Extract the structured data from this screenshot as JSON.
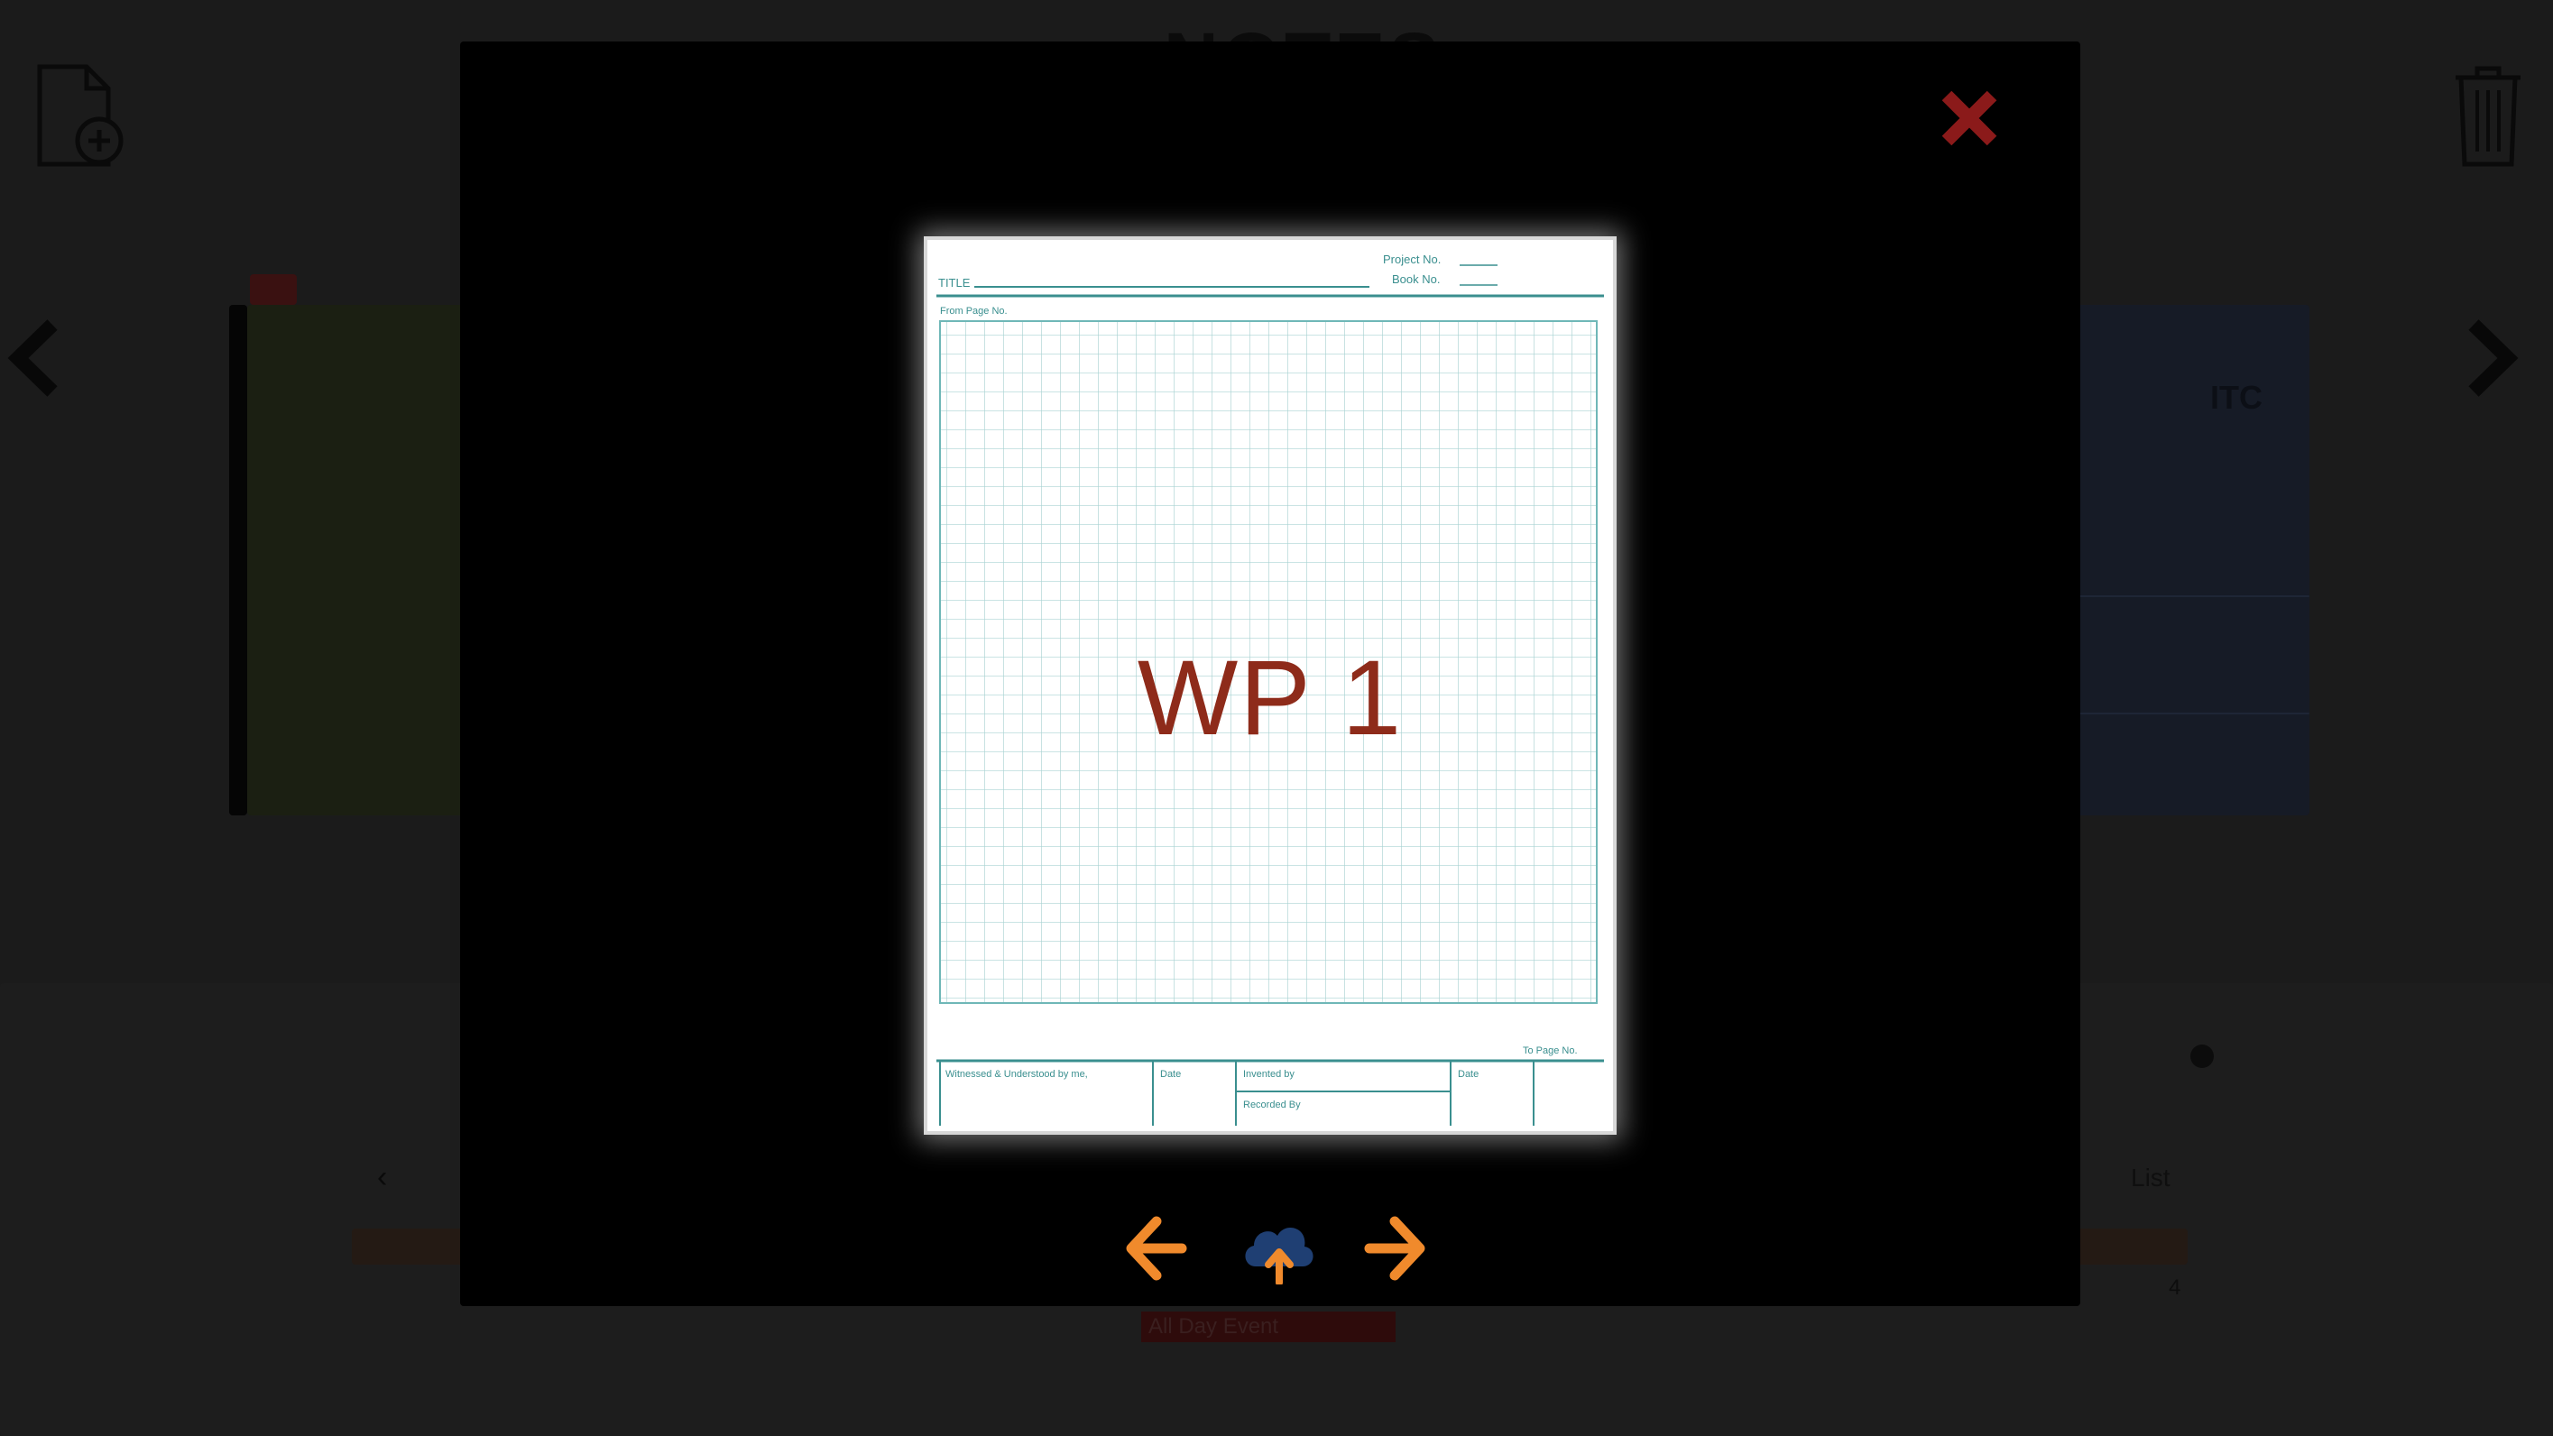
{
  "app": {
    "title": "NOTES",
    "new_note_icon": "file-plus-icon",
    "trash_icon": "trash-icon",
    "right_card_label": "ITC",
    "list_label": "List",
    "count": "4",
    "event_label": "All Day Event"
  },
  "modal": {
    "close_icon": "close-icon",
    "image_label": "WP 1",
    "sheet": {
      "title_label": "TITLE",
      "project_label": "Project No.",
      "book_label": "Book No.",
      "from_page": "From Page No.",
      "to_page": "To Page No.",
      "witnessed": "Witnessed & Understood by me,",
      "date_label": "Date",
      "invented_label": "Invented by",
      "date2_label": "Date",
      "recorded_label": "Recorded By"
    },
    "prev_icon": "arrow-left-icon",
    "upload_icon": "cloud-upload-icon",
    "next_icon": "arrow-right-icon"
  },
  "colors": {
    "accent_orange": "#f08a2c",
    "close_red": "#8b1a1a",
    "upload_blue": "#1f3f73",
    "grid_teal": "#6fb7b7",
    "label_red": "#8e2b1a"
  }
}
